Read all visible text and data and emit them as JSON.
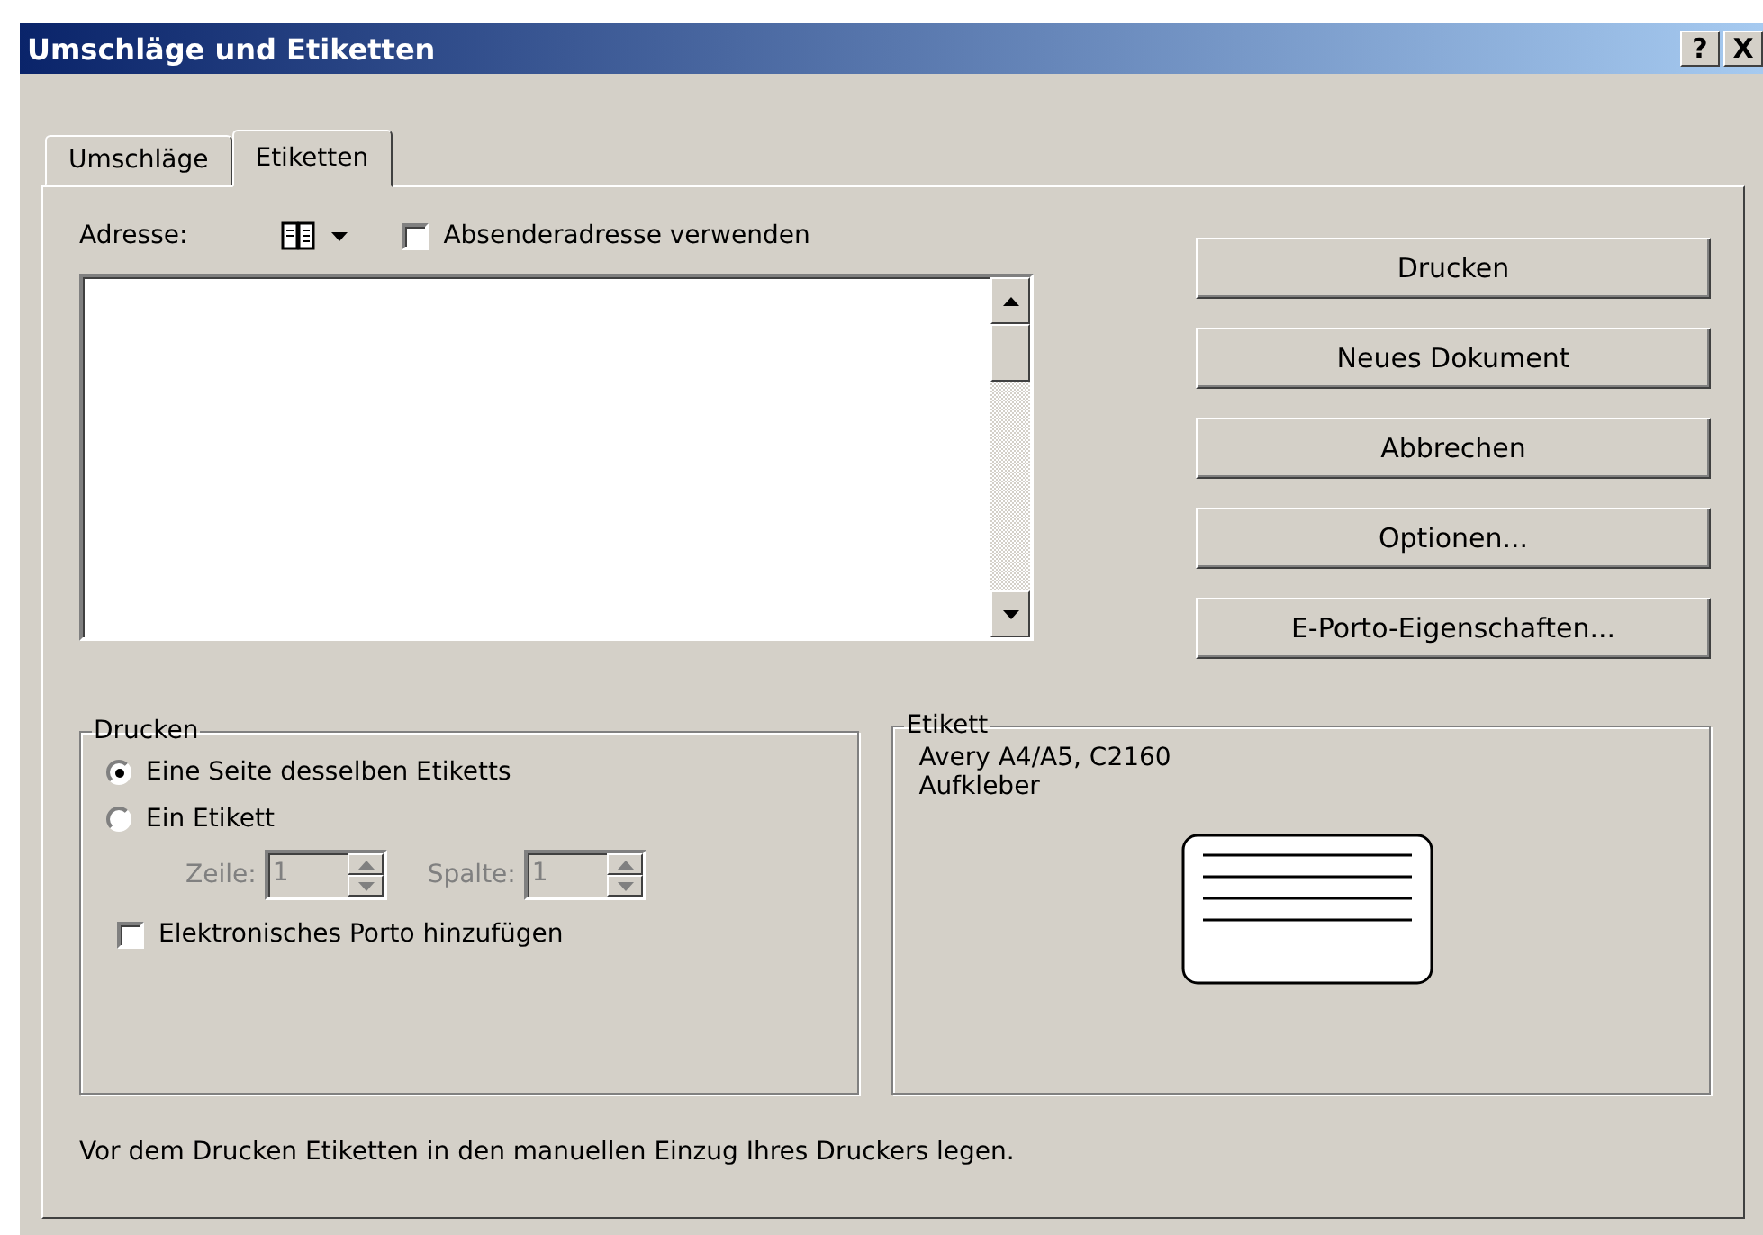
{
  "window": {
    "title": "Umschläge und Etiketten",
    "help_button": "?",
    "close_button": "X"
  },
  "tabs": [
    {
      "label": "Umschläge",
      "selected": false
    },
    {
      "label": "Etiketten",
      "selected": true
    }
  ],
  "address": {
    "label": "Adresse:"
  },
  "use_sender_address": {
    "label": "Absenderadresse verwenden",
    "checked": false
  },
  "buttons": [
    "Drucken",
    "Neues Dokument",
    "Abbrechen",
    "Optionen...",
    "E-Porto-Eigenschaften..."
  ],
  "print_group": {
    "title": "Drucken",
    "options": [
      {
        "label": "Eine Seite desselben Etiketts",
        "selected": true
      },
      {
        "label": "Ein Etikett",
        "selected": false
      }
    ],
    "spinners": [
      {
        "label": "Zeile:",
        "value": "1",
        "disabled": true
      },
      {
        "label": "Spalte:",
        "value": "1",
        "disabled": true
      }
    ],
    "electronic_postage": {
      "label": "Elektronisches Porto hinzufügen",
      "checked": false
    }
  },
  "label_group": {
    "title": "Etikett",
    "lines": [
      "Avery A4/A5, C2160",
      "Aufkleber"
    ]
  },
  "footer": "Vor dem Drucken Etiketten in den manuellen Einzug Ihres Druckers legen."
}
